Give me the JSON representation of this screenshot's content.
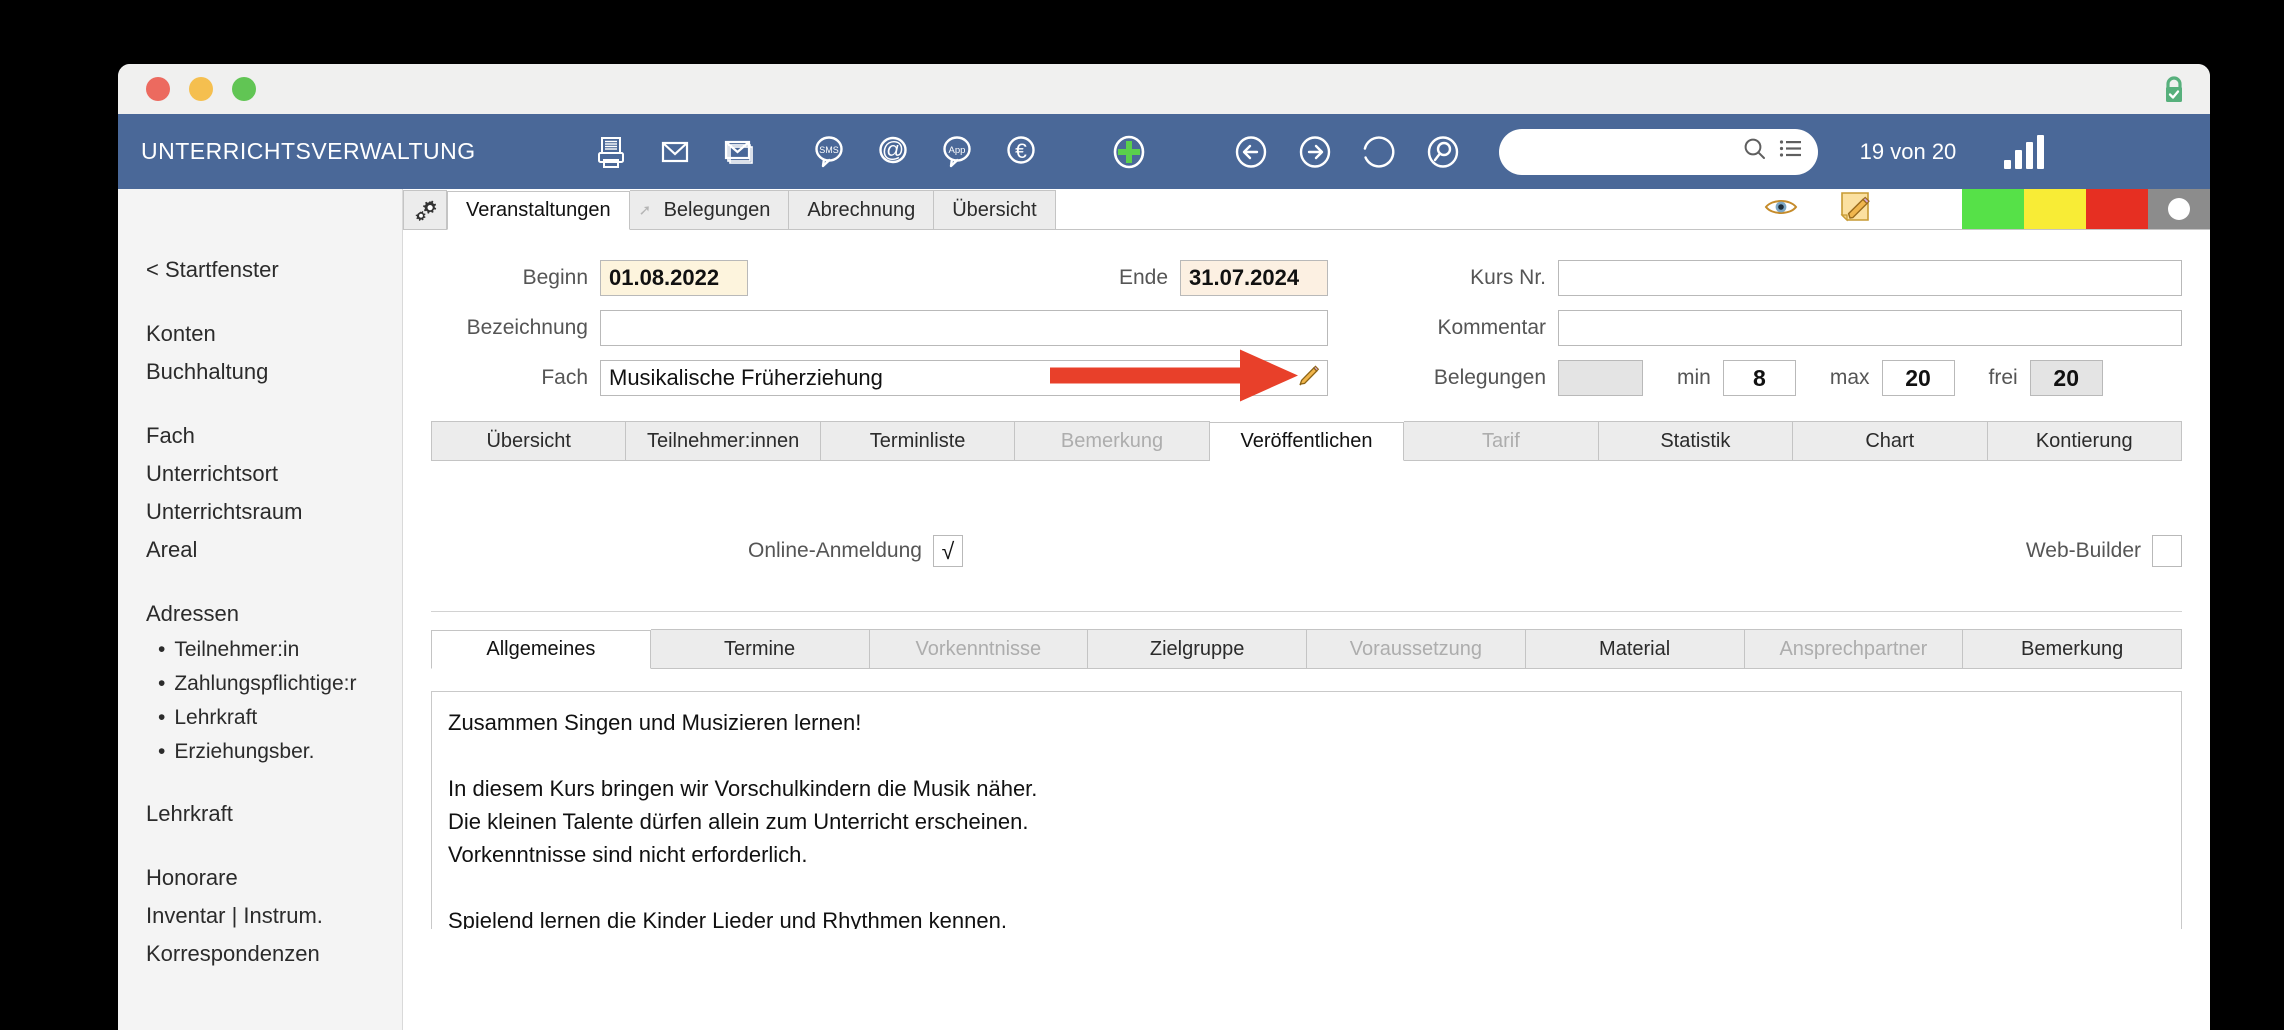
{
  "window": {
    "traffic_lights": [
      "close",
      "minimize",
      "maximize"
    ],
    "lock_icon": "lock-check-icon"
  },
  "toolbar": {
    "app_title": "UNTERRICHTSVERWALTUNG",
    "icons": [
      {
        "name": "printer-icon",
        "label": "Drucken"
      },
      {
        "name": "envelope-icon",
        "label": "E-Mail"
      },
      {
        "name": "envelopes-icon",
        "label": "Serien-E-Mail"
      },
      {
        "name": "sms-bubble-icon",
        "label": "SMS"
      },
      {
        "name": "at-bubble-icon",
        "label": "@"
      },
      {
        "name": "app-bubble-icon",
        "label": "App"
      },
      {
        "name": "euro-circle-icon",
        "label": "€"
      },
      {
        "name": "add-plus-icon",
        "label": "Neu"
      },
      {
        "name": "arrow-back-icon",
        "label": "Zurück"
      },
      {
        "name": "arrow-forward-icon",
        "label": "Vor"
      },
      {
        "name": "refresh-icon",
        "label": "Aktualisieren"
      },
      {
        "name": "search-circle-icon",
        "label": "Suchen"
      }
    ],
    "search": {
      "value": "",
      "placeholder": ""
    },
    "record_count": "19 von 20",
    "signal_icon": "bar-chart-icon"
  },
  "sidebar": {
    "back_link": "< Startfenster",
    "groups": [
      {
        "items": [
          "Konten",
          "Buchhaltung"
        ]
      },
      {
        "items": [
          "Fach",
          "Unterrichtsort",
          "Unterrichtsraum",
          "Areal"
        ]
      },
      {
        "header": "Adressen",
        "sub": [
          "Teilnehmer:in",
          "Zahlungspflichtige:r",
          "Lehrkraft",
          "Erziehungsber."
        ]
      },
      {
        "items": [
          "Lehrkraft"
        ]
      },
      {
        "items": [
          "Honorare",
          "Inventar | Instrum.",
          "Korrespondenzen"
        ]
      }
    ]
  },
  "top_tabs": {
    "gear_icon": "gear-icon",
    "items": [
      {
        "label": "Veranstaltungen",
        "active": true,
        "disabled": false,
        "pin": false
      },
      {
        "label": "Belegungen",
        "active": false,
        "disabled": false,
        "pin": true
      },
      {
        "label": "Abrechnung",
        "active": false,
        "disabled": false,
        "pin": false
      },
      {
        "label": "Übersicht",
        "active": false,
        "disabled": false,
        "pin": false
      }
    ]
  },
  "status": {
    "eye_icon": "eye-icon",
    "note_icon": "note-pencil-icon",
    "swatches": [
      {
        "name": "status-green",
        "color": "#56e148"
      },
      {
        "name": "status-yellow",
        "color": "#f8ec36"
      },
      {
        "name": "status-red",
        "color": "#e62f22"
      },
      {
        "name": "status-gray",
        "color": "#8c8c8c"
      }
    ]
  },
  "form": {
    "beginn": {
      "label": "Beginn",
      "value": "01.08.2022"
    },
    "ende": {
      "label": "Ende",
      "value": "31.07.2024"
    },
    "bezeichnung": {
      "label": "Bezeichnung",
      "value": ""
    },
    "fach": {
      "label": "Fach",
      "value": "Musikalische Früherziehung",
      "edit_icon": "pencil-icon"
    },
    "kursnr": {
      "label": "Kurs Nr.",
      "value": ""
    },
    "kommentar": {
      "label": "Kommentar",
      "value": ""
    },
    "belegungen": {
      "label": "Belegungen",
      "value": ""
    },
    "min": {
      "label": "min",
      "value": "8"
    },
    "max": {
      "label": "max",
      "value": "20"
    },
    "frei": {
      "label": "frei",
      "value": "20"
    },
    "annotation_arrow": "red-arrow-annotation"
  },
  "mid_tabs": {
    "items": [
      {
        "label": "Übersicht",
        "active": false,
        "disabled": false
      },
      {
        "label": "Teilnehmer:innen",
        "active": false,
        "disabled": false
      },
      {
        "label": "Terminliste",
        "active": false,
        "disabled": false
      },
      {
        "label": "Bemerkung",
        "active": false,
        "disabled": true
      },
      {
        "label": "Veröffentlichen",
        "active": true,
        "disabled": false
      },
      {
        "label": "Tarif",
        "active": false,
        "disabled": true
      },
      {
        "label": "Statistik",
        "active": false,
        "disabled": false
      },
      {
        "label": "Chart",
        "active": false,
        "disabled": false
      },
      {
        "label": "Kontierung",
        "active": false,
        "disabled": false
      }
    ]
  },
  "publish": {
    "online_anmeldung": {
      "label": "Online-Anmeldung",
      "checked": true,
      "mark": "√"
    },
    "web_builder": {
      "label": "Web-Builder",
      "checked": false,
      "mark": ""
    }
  },
  "bottom_tabs": {
    "items": [
      {
        "label": "Allgemeines",
        "active": true,
        "disabled": false
      },
      {
        "label": "Termine",
        "active": false,
        "disabled": false
      },
      {
        "label": "Vorkenntnisse",
        "active": false,
        "disabled": true
      },
      {
        "label": "Zielgruppe",
        "active": false,
        "disabled": false
      },
      {
        "label": "Voraussetzung",
        "active": false,
        "disabled": true
      },
      {
        "label": "Material",
        "active": false,
        "disabled": false
      },
      {
        "label": "Ansprechpartner",
        "active": false,
        "disabled": true
      },
      {
        "label": "Bemerkung",
        "active": false,
        "disabled": false
      }
    ]
  },
  "description": {
    "lines": [
      "Zusammen Singen und Musizieren lernen!",
      "",
      "In diesem Kurs bringen wir Vorschulkindern die Musik näher.",
      "Die kleinen Talente dürfen allein zum Unterricht erscheinen.",
      "Vorkenntnisse sind nicht erforderlich.",
      "",
      "Spielend lernen die Kinder Lieder und Rhythmen kennen."
    ]
  }
}
